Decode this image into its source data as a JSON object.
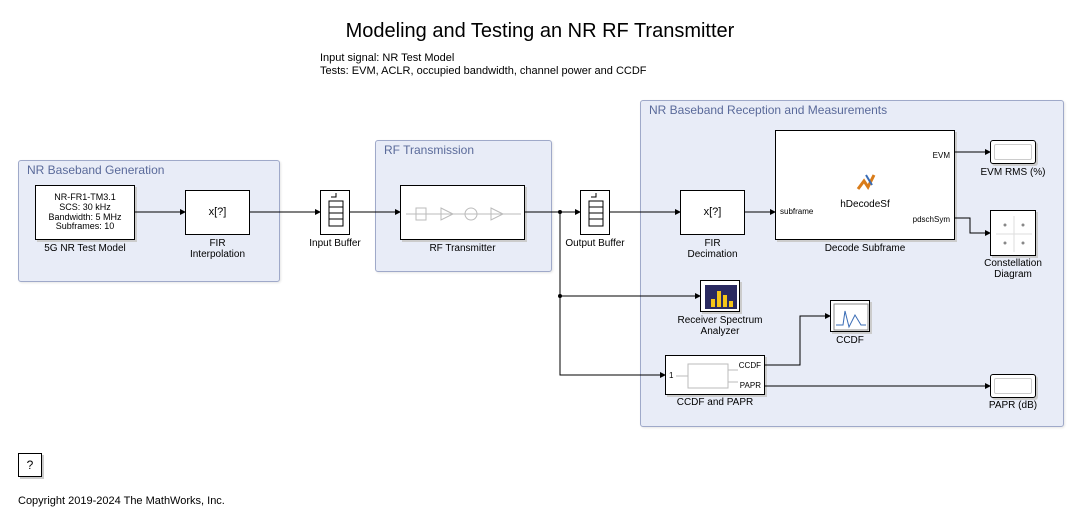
{
  "title": "Modeling and Testing an NR RF Transmitter",
  "subtitle_l1": "Input signal: NR Test Model",
  "subtitle_l2": "Tests: EVM, ACLR, occupied bandwidth, channel power and CCDF",
  "groups": {
    "gen": {
      "title": "NR Baseband Generation"
    },
    "rf": {
      "title": "RF Transmission"
    },
    "rx": {
      "title": "NR Baseband Reception and Measurements"
    }
  },
  "blocks": {
    "testmodel": {
      "l1": "NR-FR1-TM3.1",
      "l2": "SCS: 30 kHz",
      "l3": "Bandwidth: 5 MHz",
      "l4": "Subframes: 10",
      "label": "5G NR Test Model"
    },
    "fir_interp": {
      "text": "x[?]",
      "label": "FIR\nInterpolation"
    },
    "input_buf": {
      "label": "Input Buffer"
    },
    "rf_tx": {
      "label": "RF Transmitter"
    },
    "output_buf": {
      "label": "Output Buffer"
    },
    "fir_decim": {
      "text": "x[?]",
      "label": "FIR\nDecimation"
    },
    "decode": {
      "text": "hDecodeSf",
      "label": "Decode Subframe",
      "p_in": "subframe",
      "p_out1": "EVM",
      "p_out2": "pdschSym"
    },
    "evm_disp": {
      "label": "EVM RMS (%)"
    },
    "constel": {
      "label": "Constellation Diagram"
    },
    "rx_spec": {
      "label": "Receiver Spectrum Analyzer"
    },
    "ccdf": {
      "label": "CCDF"
    },
    "ccdf_papr": {
      "label": "CCDF and PAPR",
      "in": "1",
      "out1": "CCDF",
      "out2": "PAPR"
    },
    "papr_disp": {
      "label": "PAPR (dB)"
    }
  },
  "help": "?",
  "copyright": "Copyright 2019-2024 The MathWorks, Inc."
}
